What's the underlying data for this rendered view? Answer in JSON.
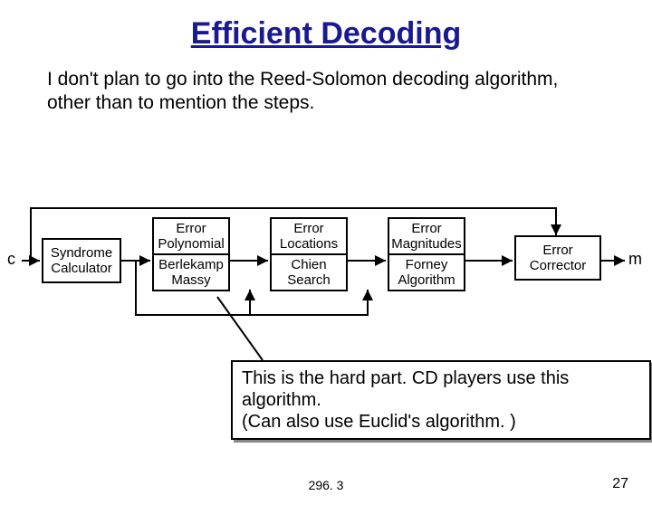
{
  "title": "Efficient Decoding",
  "intro": "I don't plan to go into the Reed-Solomon decoding algorithm, other than to mention the steps.",
  "io": {
    "in": "c",
    "out": "m"
  },
  "blocks": {
    "syndrome": {
      "l1": "Syndrome",
      "l2": "Calculator"
    },
    "errpoly": {
      "l1": "Error",
      "l2": "Polynomial"
    },
    "berlekamp": {
      "l1": "Berlekamp",
      "l2": "Massy"
    },
    "errloc": {
      "l1": "Error",
      "l2": "Locations"
    },
    "chien": {
      "l1": "Chien",
      "l2": "Search"
    },
    "errmag": {
      "l1": "Error",
      "l2": "Magnitudes"
    },
    "forney": {
      "l1": "Forney",
      "l2": "Algorithm"
    },
    "corrector": {
      "l1": "Error",
      "l2": "Corrector"
    }
  },
  "note": {
    "l1": "This is the hard part.  CD players use this algorithm.",
    "l2": "(Can also use Euclid's algorithm. )"
  },
  "footer": "296. 3",
  "page": "27"
}
